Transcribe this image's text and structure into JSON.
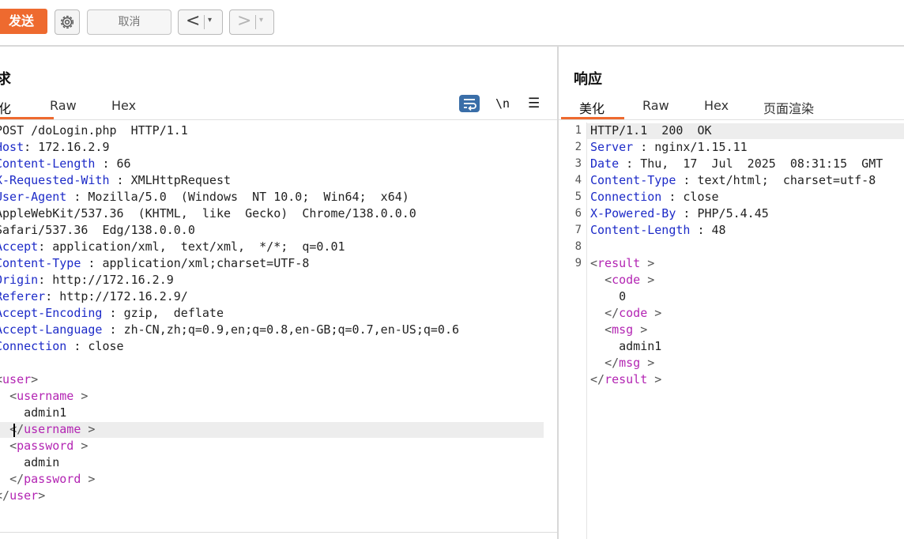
{
  "toolbar": {
    "send_label": "发送",
    "settings_icon": "gear-icon",
    "cancel_label": "取消",
    "back_arrow": "<",
    "forward_arrow": ">",
    "dropdown_glyph": "▾",
    "accent_color": "#ee6a2f"
  },
  "request": {
    "title": "求",
    "tabs": [
      "化",
      "Raw",
      "Hex"
    ],
    "active_tab": "化",
    "icons": {
      "wrap": "word-wrap-icon",
      "newline": "\\n",
      "menu": "☰"
    },
    "headers": [
      {
        "key": "POST /doLogin.php  HTTP/1.1",
        "sep": "",
        "value": "",
        "plain": true
      },
      {
        "key": "Host",
        "sep": ": ",
        "value": "172.16.2.9"
      },
      {
        "key": "Content-Length",
        "sep": " : ",
        "value": "66"
      },
      {
        "key": "X-Requested-With",
        "sep": " : ",
        "value": "XMLHttpRequest"
      },
      {
        "key": "User-Agent",
        "sep": " : ",
        "value": "Mozilla/5.0  (Windows  NT 10.0;  Win64;  x64)"
      },
      {
        "key": "AppleWebKit/537.36  (KHTML,  like  Gecko)  Chrome/138.0.0.0",
        "sep": "",
        "value": "",
        "plain": true
      },
      {
        "key": "Safari/537.36  Edg/138.0.0.0",
        "sep": "",
        "value": "",
        "plain": true
      },
      {
        "key": "Accept",
        "sep": ": ",
        "value": "application/xml,  text/xml,  */*;  q=0.01"
      },
      {
        "key": "Content-Type",
        "sep": " : ",
        "value": "application/xml;charset=UTF-8"
      },
      {
        "key": "Origin",
        "sep": ": ",
        "value": "http://172.16.2.9"
      },
      {
        "key": "Referer",
        "sep": ": ",
        "value": "http://172.16.2.9/"
      },
      {
        "key": "Accept-Encoding",
        "sep": " : ",
        "value": "gzip,  deflate"
      },
      {
        "key": "Accept-Language",
        "sep": " : ",
        "value": "zh-CN,zh;q=0.9,en;q=0.8,en-GB;q=0.7,en-US;q=0.6"
      },
      {
        "key": "Connection",
        "sep": " : ",
        "value": "close"
      }
    ],
    "body": [
      {
        "indent": "",
        "open": "<",
        "tag": "user",
        "close": ">"
      },
      {
        "indent": "  ",
        "open": "<",
        "tag": "username",
        "close": " >"
      },
      {
        "indent": "    ",
        "text": "admin1"
      },
      {
        "indent": "  ",
        "open": "</",
        "tag": "username",
        "close": " >"
      },
      {
        "indent": "  ",
        "open": "<",
        "tag": "password",
        "close": " >"
      },
      {
        "indent": "    ",
        "text": "admin"
      },
      {
        "indent": "  ",
        "open": "</",
        "tag": "password",
        "close": " >"
      },
      {
        "indent": "",
        "open": "</",
        "tag": "user",
        "close": ">"
      }
    ]
  },
  "response": {
    "title": "响应",
    "tabs": [
      "美化",
      "Raw",
      "Hex",
      "页面渲染"
    ],
    "active_tab": "美化",
    "line_numbers": [
      "1",
      "2",
      "3",
      "4",
      "5",
      "6",
      "7",
      "8",
      "9"
    ],
    "headers": [
      {
        "key": "HTTP/1.1  200  OK",
        "sep": "",
        "value": "",
        "plain": true
      },
      {
        "key": "Server",
        "sep": " : ",
        "value": "nginx/1.15.11"
      },
      {
        "key": "Date",
        "sep": " : ",
        "value": "Thu,  17  Jul  2025  08:31:15  GMT"
      },
      {
        "key": "Content-Type",
        "sep": " : ",
        "value": "text/html;  charset=utf-8"
      },
      {
        "key": "Connection",
        "sep": " : ",
        "value": "close"
      },
      {
        "key": "X-Powered-By",
        "sep": " : ",
        "value": "PHP/5.4.45"
      },
      {
        "key": "Content-Length",
        "sep": " : ",
        "value": "48"
      }
    ],
    "body": [
      {
        "indent": "",
        "open": "<",
        "tag": "result",
        "close": " >"
      },
      {
        "indent": "  ",
        "open": "<",
        "tag": "code",
        "close": " >"
      },
      {
        "indent": "    ",
        "text": "0"
      },
      {
        "indent": "  ",
        "open": "</",
        "tag": "code",
        "close": " >"
      },
      {
        "indent": "  ",
        "open": "<",
        "tag": "msg",
        "close": " >"
      },
      {
        "indent": "    ",
        "text": "admin1"
      },
      {
        "indent": "  ",
        "open": "</",
        "tag": "msg",
        "close": " >"
      },
      {
        "indent": "",
        "open": "</",
        "tag": "result",
        "close": " >"
      }
    ]
  }
}
